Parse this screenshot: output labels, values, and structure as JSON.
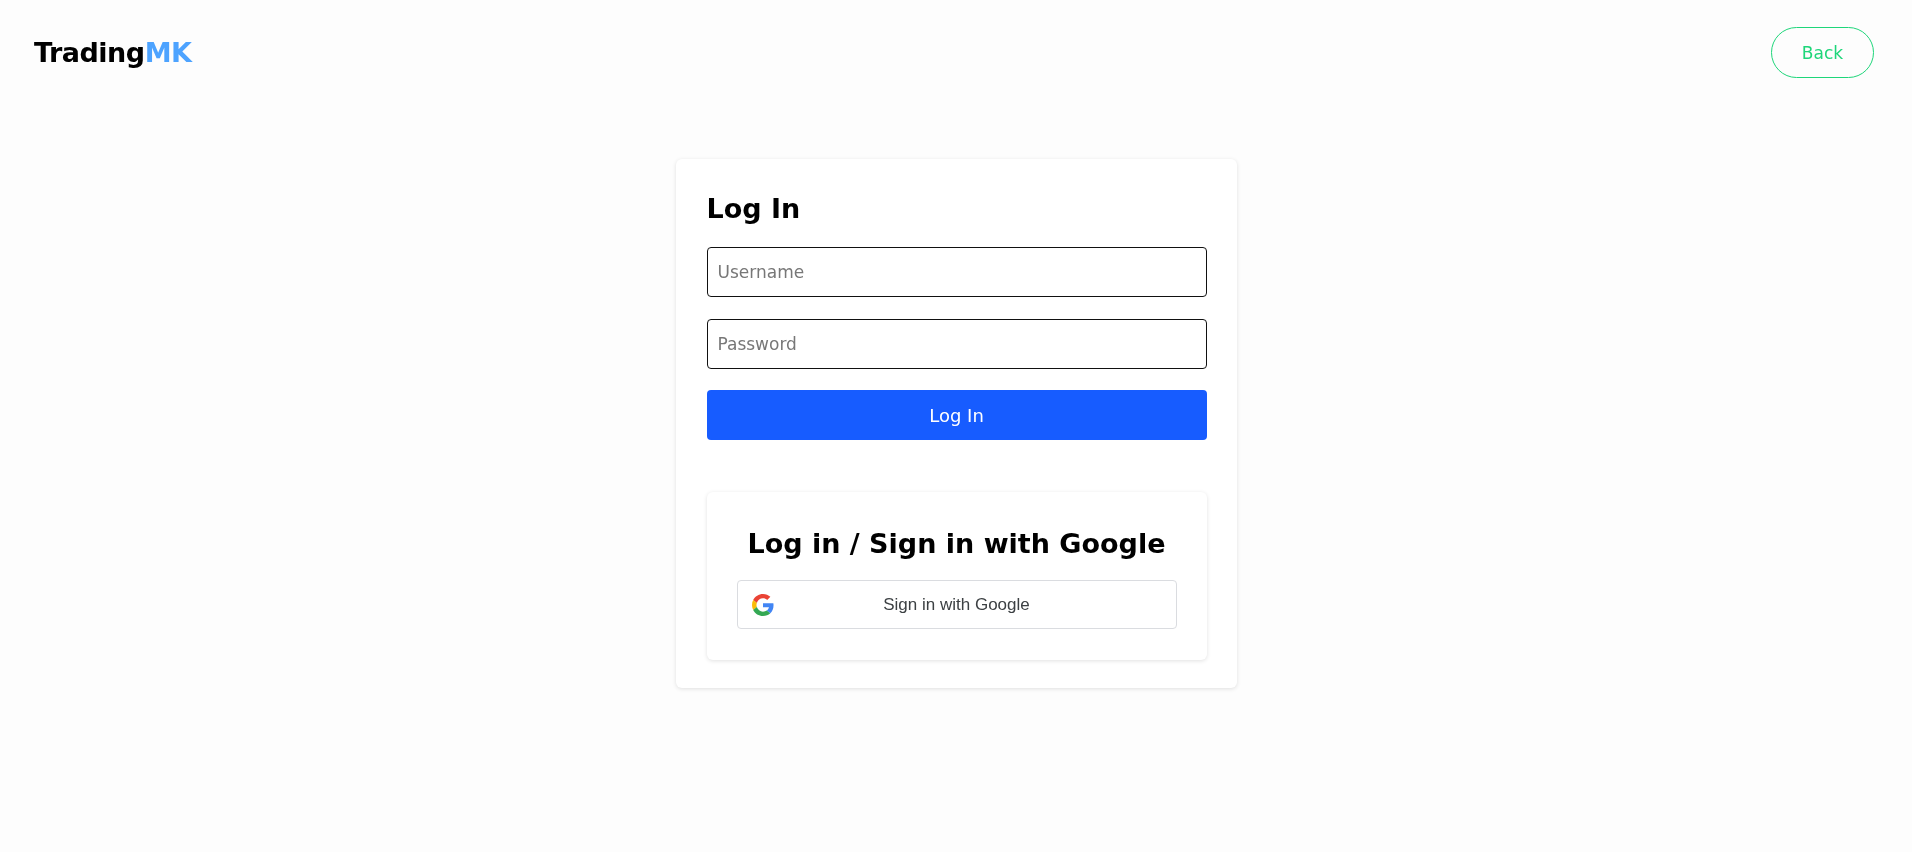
{
  "header": {
    "logo": {
      "text": "Trading",
      "accent": "MK"
    },
    "back_button": "Back"
  },
  "login": {
    "title": "Log In",
    "fields": [
      {
        "placeholder": "Username"
      },
      {
        "placeholder": "Password"
      }
    ],
    "submit": "Log In",
    "google": {
      "title": "Log in / Sign in with Google",
      "button": "Sign in with Google"
    }
  }
}
